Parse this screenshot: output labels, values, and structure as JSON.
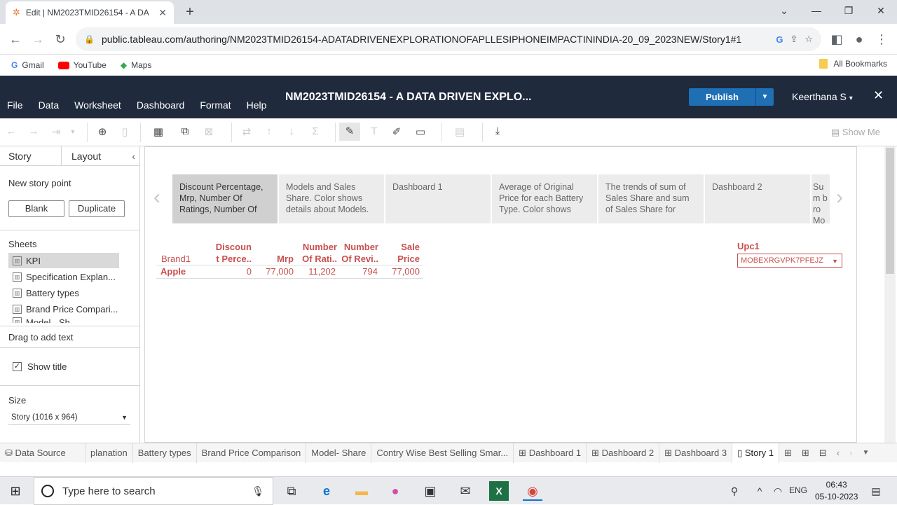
{
  "browser": {
    "tab_title": "Edit | NM2023TMID26154 - A DA",
    "url": "public.tableau.com/authoring/NM2023TMID26154-ADATADRIVENEXPLORATIONOFAPLLESIPHONEIMPACTININDIA-20_09_2023NEW/Story1#1",
    "bookmarks": [
      "Gmail",
      "YouTube",
      "Maps"
    ],
    "all_bookmarks": "All Bookmarks"
  },
  "tableau": {
    "menu": [
      "File",
      "Data",
      "Worksheet",
      "Dashboard",
      "Format",
      "Help"
    ],
    "title": "NM2023TMID26154 - A DATA DRIVEN EXPLO...",
    "publish": "Publish",
    "user": "Keerthana S",
    "show_me": "Show Me"
  },
  "left_panel": {
    "tab_story": "Story",
    "tab_layout": "Layout",
    "new_story_point": "New story point",
    "blank": "Blank",
    "duplicate": "Duplicate",
    "sheets_header": "Sheets",
    "sheets": [
      "KPI",
      "Specification Explan...",
      "Battery types",
      "Brand Price Compari...",
      "Model - Sh..."
    ],
    "drag_text": "Drag to add text",
    "show_title": "Show title",
    "size_header": "Size",
    "size_value": "Story (1016 x 964)"
  },
  "story_points": [
    "Discount Percentage, Mrp, Number Of Ratings, Number Of",
    "Models and Sales Share.  Color shows details about Models.",
    "Dashboard 1",
    "Average of Original Price for each Battery Type.  Color shows",
    "The trends of sum of Sales Share and sum of Sales Share for",
    "Dashboard 2",
    "Sum bro Mo"
  ],
  "kpi": {
    "headers": {
      "brand": "Brand1",
      "discount_1": "Discoun",
      "discount_2": "t Perce..",
      "mrp": "Mrp",
      "ratings_1": "Number",
      "ratings_2": "Of Rati..",
      "reviews_1": "Number",
      "reviews_2": "Of Revi..",
      "sale_1": "Sale",
      "sale_2": "Price"
    },
    "row": {
      "brand": "Apple",
      "discount": "0",
      "mrp": "77,000",
      "ratings": "11,202",
      "reviews": "794",
      "sale": "77,000"
    },
    "filter_label": "Upc1",
    "filter_value": "MOBEXRGVPK7PFEJZ"
  },
  "sheet_tabs": [
    "Data Source",
    "planation",
    "Battery types",
    "Brand Price Comparison",
    "Model- Share",
    "Contry Wise Best Selling Smar...",
    "Dashboard 1",
    "Dashboard 2",
    "Dashboard 3",
    "Story 1"
  ],
  "taskbar": {
    "search_placeholder": "Type here to search",
    "lang": "ENG",
    "time": "06:43",
    "date": "05-10-2023"
  },
  "colors": {
    "kpi_red": "#c8504f",
    "header_bg": "#1f2a3d",
    "publish_blue": "#1f6fb5"
  }
}
